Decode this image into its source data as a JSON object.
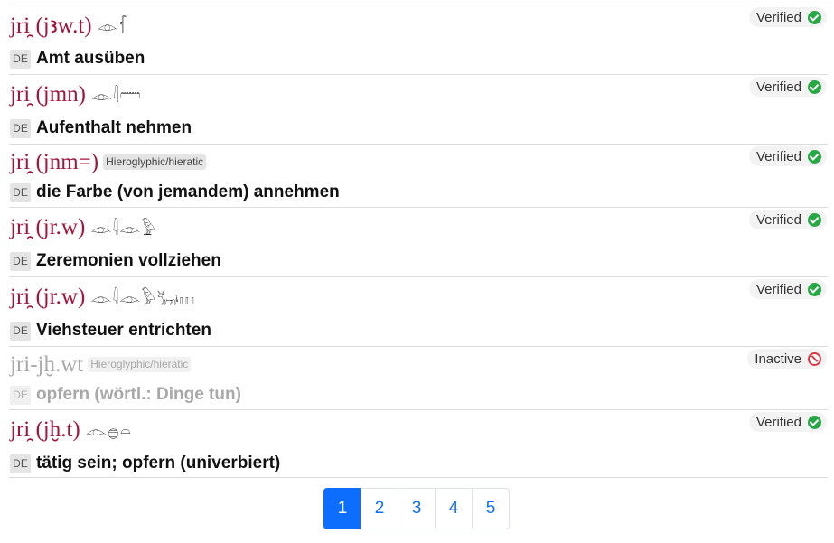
{
  "entries": [
    {
      "translit": "jri̯ (jꜣw.t)",
      "hieroglyphs": "𓁹𓆳",
      "script_badge": "",
      "lang": "DE",
      "translation": "Amt ausüben",
      "status": "Verified",
      "status_icon": "check-circle-icon"
    },
    {
      "translit": "jri̯ (jmn)",
      "hieroglyphs": "𓁹𓇋𓏠",
      "script_badge": "",
      "lang": "DE",
      "translation": "Aufenthalt nehmen",
      "status": "Verified",
      "status_icon": "check-circle-icon"
    },
    {
      "translit": "jri̯ (jnm=)",
      "hieroglyphs": "",
      "script_badge": "Hieroglyphic/hieratic",
      "lang": "DE",
      "translation": "die Farbe (von jemandem) annehmen",
      "status": "Verified",
      "status_icon": "check-circle-icon"
    },
    {
      "translit": "jri̯ (jr.w)",
      "hieroglyphs": "𓁹𓇋𓁹𓅱",
      "script_badge": "",
      "lang": "DE",
      "translation": "Zeremonien vollziehen",
      "status": "Verified",
      "status_icon": "check-circle-icon"
    },
    {
      "translit": "jri̯ (jr.w)",
      "hieroglyphs": "𓁹𓇋𓁹𓅱𓃒𓏥",
      "script_badge": "",
      "lang": "DE",
      "translation": "Viehsteuer entrichten",
      "status": "Verified",
      "status_icon": "check-circle-icon"
    },
    {
      "translit": "jri-jḫ.wt",
      "hieroglyphs": "",
      "script_badge": "Hieroglyphic/hieratic",
      "lang": "DE",
      "translation": "opfern (wörtl.: Dinge tun)",
      "status": "Inactive",
      "status_icon": "ban-icon"
    },
    {
      "translit": "jri̯ (jḫ.t)",
      "hieroglyphs": "𓁹𓐍𓏏",
      "script_badge": "",
      "lang": "DE",
      "translation": "tätig sein; opfern (univerbiert)",
      "status": "Verified",
      "status_icon": "check-circle-icon"
    }
  ],
  "pagination": {
    "pages": [
      "1",
      "2",
      "3",
      "4",
      "5"
    ],
    "current": "1"
  },
  "colors": {
    "lemma": "#a3143a",
    "verified": "#27a745",
    "inactive": "#dc3545",
    "page_active": "#0d6efd"
  }
}
